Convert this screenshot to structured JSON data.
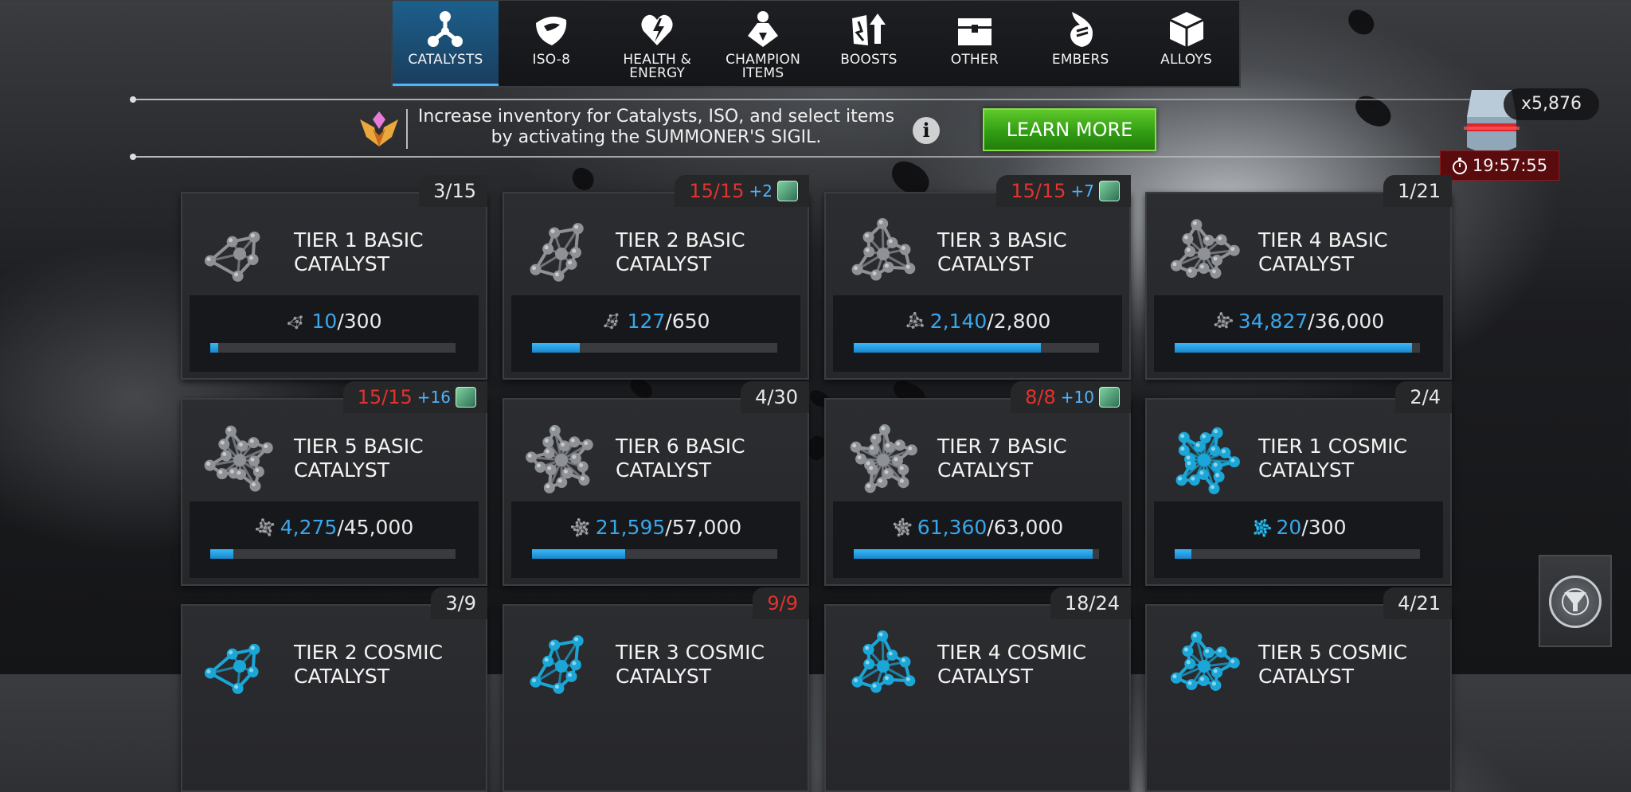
{
  "tabs": [
    {
      "label": "CATALYSTS",
      "icon": "catalyst-icon",
      "active": true
    },
    {
      "label": "ISO-8",
      "icon": "iso8-icon",
      "active": false
    },
    {
      "label": "HEALTH & ENERGY",
      "icon": "health-energy-icon",
      "active": false
    },
    {
      "label": "CHAMPION ITEMS",
      "icon": "champion-items-icon",
      "active": false
    },
    {
      "label": "BOOSTS",
      "icon": "boosts-icon",
      "active": false
    },
    {
      "label": "OTHER",
      "icon": "chest-icon",
      "active": false
    },
    {
      "label": "EMBERS",
      "icon": "ember-icon",
      "active": false
    },
    {
      "label": "ALLOYS",
      "icon": "alloy-cube-icon",
      "active": false
    }
  ],
  "banner": {
    "line1": "Increase inventory for Catalysts, ISO, and select items",
    "line2": "by activating the SUMMONER'S SIGIL.",
    "button": "LEARN MORE"
  },
  "currency": {
    "count": "x5,876",
    "timer": "19:57:55"
  },
  "colors": {
    "accent": "#3aa6ea",
    "full": "#e2332f",
    "button_green": "#3fa81a"
  },
  "cards": [
    {
      "title_1": "TIER 1 BASIC",
      "title_2": "CATALYST",
      "count_cur": "3",
      "count_max": "15",
      "full": false,
      "extra": "",
      "prog_cur": "10",
      "prog_max": "300",
      "progress": 0.033,
      "cosmic": false
    },
    {
      "title_1": "TIER 2 BASIC",
      "title_2": "CATALYST",
      "count_cur": "15",
      "count_max": "15",
      "full": true,
      "extra": "+2",
      "prog_cur": "127",
      "prog_max": "650",
      "progress": 0.195,
      "cosmic": false
    },
    {
      "title_1": "TIER 3 BASIC",
      "title_2": "CATALYST",
      "count_cur": "15",
      "count_max": "15",
      "full": true,
      "extra": "+7",
      "prog_cur": "2,140",
      "prog_max": "2,800",
      "progress": 0.764,
      "cosmic": false
    },
    {
      "title_1": "TIER 4 BASIC",
      "title_2": "CATALYST",
      "count_cur": "1",
      "count_max": "21",
      "full": false,
      "extra": "",
      "prog_cur": "34,827",
      "prog_max": "36,000",
      "progress": 0.967,
      "cosmic": false
    },
    {
      "title_1": "TIER 5 BASIC",
      "title_2": "CATALYST",
      "count_cur": "15",
      "count_max": "15",
      "full": true,
      "extra": "+16",
      "prog_cur": "4,275",
      "prog_max": "45,000",
      "progress": 0.095,
      "cosmic": false
    },
    {
      "title_1": "TIER 6 BASIC",
      "title_2": "CATALYST",
      "count_cur": "4",
      "count_max": "30",
      "full": false,
      "extra": "",
      "prog_cur": "21,595",
      "prog_max": "57,000",
      "progress": 0.379,
      "cosmic": false
    },
    {
      "title_1": "TIER 7 BASIC",
      "title_2": "CATALYST",
      "count_cur": "8",
      "count_max": "8",
      "full": true,
      "extra": "+10",
      "prog_cur": "61,360",
      "prog_max": "63,000",
      "progress": 0.974,
      "cosmic": false
    },
    {
      "title_1": "TIER 1 COSMIC",
      "title_2": "CATALYST",
      "count_cur": "2",
      "count_max": "4",
      "full": false,
      "extra": "",
      "prog_cur": "20",
      "prog_max": "300",
      "progress": 0.067,
      "cosmic": true
    },
    {
      "title_1": "TIER 2 COSMIC",
      "title_2": "CATALYST",
      "count_cur": "3",
      "count_max": "9",
      "full": false,
      "extra": "",
      "prog_cur": "",
      "prog_max": "",
      "progress": 0,
      "cosmic": true
    },
    {
      "title_1": "TIER 3 COSMIC",
      "title_2": "CATALYST",
      "count_cur": "9",
      "count_max": "9",
      "full": true,
      "extra": "",
      "prog_cur": "",
      "prog_max": "",
      "progress": 0,
      "cosmic": true
    },
    {
      "title_1": "TIER 4 COSMIC",
      "title_2": "CATALYST",
      "count_cur": "18",
      "count_max": "24",
      "full": false,
      "extra": "",
      "prog_cur": "",
      "prog_max": "",
      "progress": 0,
      "cosmic": true
    },
    {
      "title_1": "TIER 5 COSMIC",
      "title_2": "CATALYST",
      "count_cur": "4",
      "count_max": "21",
      "full": false,
      "extra": "",
      "prog_cur": "",
      "prog_max": "",
      "progress": 0,
      "cosmic": true
    }
  ]
}
